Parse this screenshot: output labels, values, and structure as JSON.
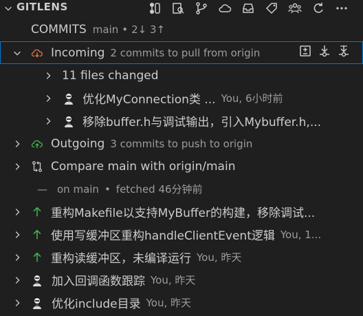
{
  "panel": {
    "title": "GITLENS",
    "toolbar_icons": [
      "graph-icon",
      "inspect-icon",
      "branches-icon",
      "cloud-icon",
      "inbox-icon",
      "tag-icon",
      "contributors-icon",
      "refresh-icon",
      "more-icon"
    ]
  },
  "commits_header": {
    "label": "COMMITS",
    "branch": "main",
    "bullet": "•",
    "status": "2↓ 3↑"
  },
  "incoming": {
    "label": "Incoming",
    "description": "2 commits to pull from origin",
    "actions": [
      "compare-icon",
      "pull-icon",
      "fetch-icon"
    ],
    "children": [
      {
        "label": "11 files changed"
      },
      {
        "label": "优化MyConnection类 ...",
        "author": "You, 6小时前"
      },
      {
        "label": "移除buffer.h与调试输出，引入Mybuffer.h,..."
      }
    ]
  },
  "outgoing": {
    "label": "Outgoing",
    "description": "3 commits to push to origin"
  },
  "compare": {
    "label": "Compare main with origin/main"
  },
  "status_line": {
    "dash": "—",
    "text1": "on main",
    "bullet": "•",
    "text2": "fetched 46分钟前"
  },
  "commits": [
    {
      "message": "重构Makefile以支持MyBuffer的构建，移除调试...",
      "meta": "",
      "icon": "arrow-up-icon"
    },
    {
      "message": "使用写缓冲区重构handleClientEvent逻辑",
      "meta": "You, 1...",
      "icon": "arrow-up-icon"
    },
    {
      "message": "重构读缓冲区，未编译运行",
      "meta": "You, 昨天",
      "icon": "arrow-up-icon"
    },
    {
      "message": "加入回调函数跟踪",
      "meta": "You, 昨天",
      "icon": "avatar"
    },
    {
      "message": "优化include目录",
      "meta": "You, 昨天",
      "icon": "avatar"
    }
  ],
  "colors": {
    "background": "#1f1f1f",
    "accent_green": "#3fb950",
    "incoming_orange": "#e5734a",
    "selection_border": "#0078d4",
    "muted": "#9d9d9d"
  }
}
